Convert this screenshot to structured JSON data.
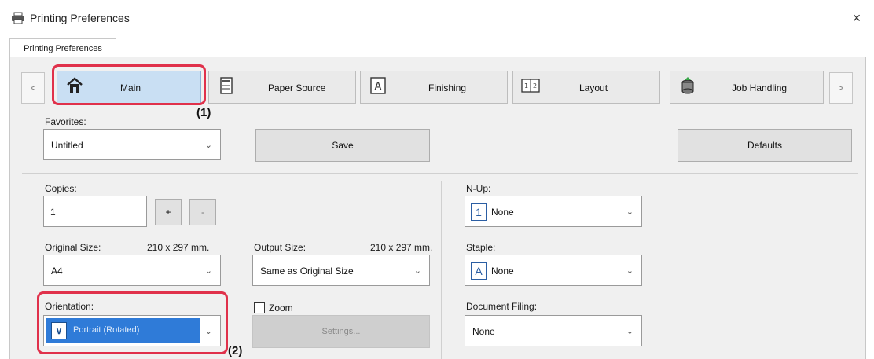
{
  "window": {
    "title": "Printing Preferences",
    "close_label": "×"
  },
  "tab": {
    "label": "Printing Preferences"
  },
  "nav": {
    "prev": "<",
    "next": ">",
    "tabs": [
      {
        "label": "Main",
        "icon": "home-icon"
      },
      {
        "label": "Paper Source",
        "icon": "paper-tray-icon"
      },
      {
        "label": "Finishing",
        "icon": "finishing-icon"
      },
      {
        "label": "Layout",
        "icon": "layout-icon"
      },
      {
        "label": "Job Handling",
        "icon": "job-handling-icon"
      }
    ]
  },
  "callouts": {
    "one": "(1)",
    "two": "(2)"
  },
  "favorites": {
    "label": "Favorites:",
    "value": "Untitled"
  },
  "buttons": {
    "save": "Save",
    "defaults": "Defaults",
    "settings": "Settings...",
    "plus": "+",
    "minus": "-"
  },
  "copies": {
    "label": "Copies:",
    "value": "1"
  },
  "original_size": {
    "label": "Original Size:",
    "dimensions": "210 x 297 mm.",
    "value": "A4"
  },
  "output_size": {
    "label": "Output Size:",
    "dimensions": "210 x 297 mm.",
    "value": "Same as Original Size"
  },
  "orientation": {
    "label": "Orientation:",
    "value": "Portrait (Rotated)"
  },
  "zoom": {
    "label": "Zoom",
    "checked": false
  },
  "nup": {
    "label": "N-Up:",
    "icon_text": "1",
    "value": "None"
  },
  "staple": {
    "label": "Staple:",
    "icon_text": "A",
    "value": "None"
  },
  "document_filing": {
    "label": "Document Filing:",
    "value": "None"
  },
  "colors": {
    "highlight": "#e0314b",
    "selected_tab": "#c9dff3",
    "selection": "#2f7bd8"
  }
}
